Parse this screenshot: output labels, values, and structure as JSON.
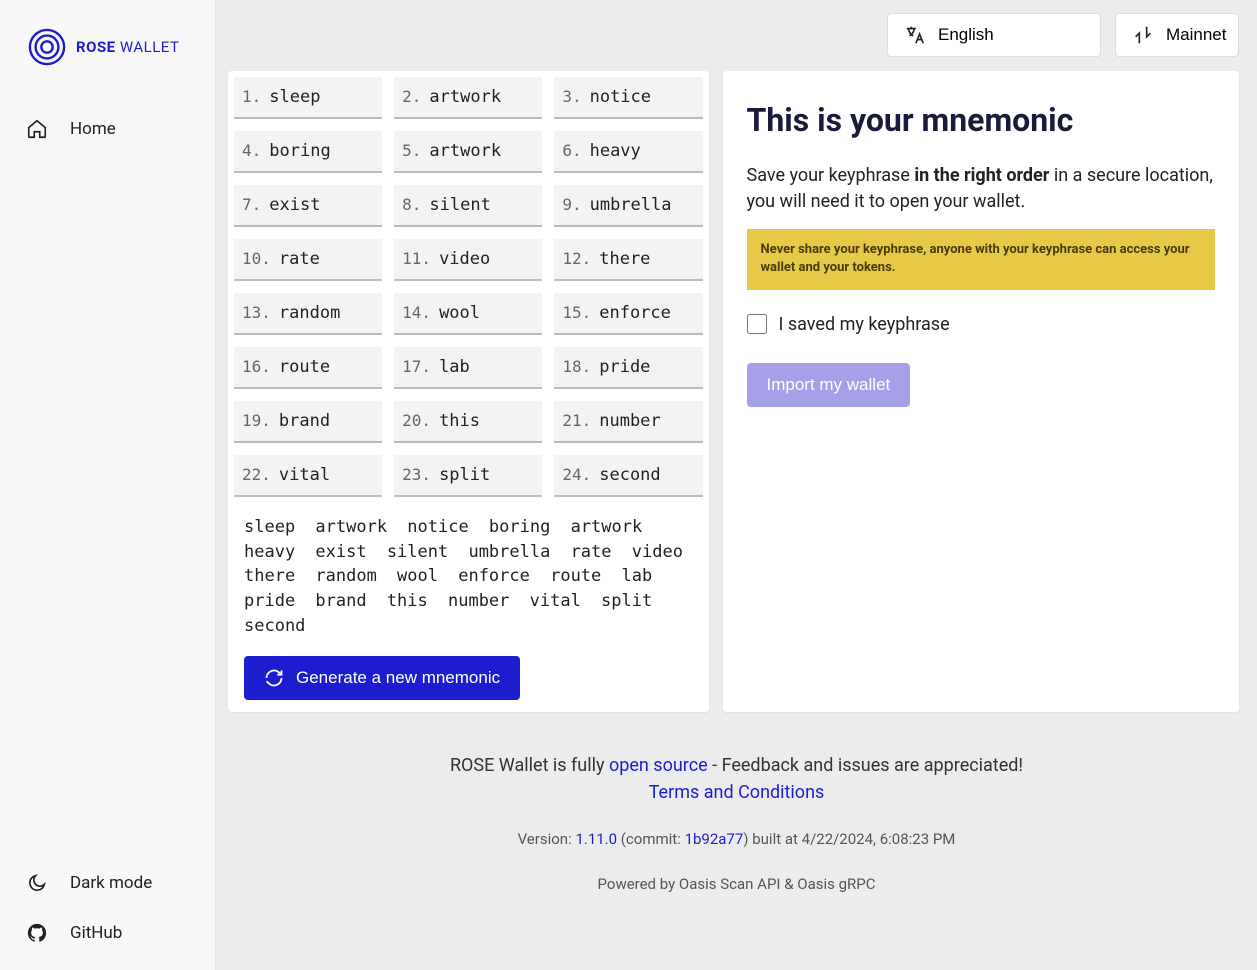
{
  "brand": {
    "rose": "ROSE",
    "wallet": "WALLET"
  },
  "sidebar": {
    "home": "Home",
    "dark": "Dark mode",
    "github": "GitHub"
  },
  "topbar": {
    "language": "English",
    "network": "Mainnet"
  },
  "mnemonic": {
    "words": [
      "sleep",
      "artwork",
      "notice",
      "boring",
      "artwork",
      "heavy",
      "exist",
      "silent",
      "umbrella",
      "rate",
      "video",
      "there",
      "random",
      "wool",
      "enforce",
      "route",
      "lab",
      "pride",
      "brand",
      "this",
      "number",
      "vital",
      "split",
      "second"
    ],
    "generate_label": "Generate a new mnemonic"
  },
  "right": {
    "title": "This is your mnemonic",
    "desc_a": "Save your keyphrase ",
    "desc_b": "in the right order",
    "desc_c": " in a secure location, you will need it to open your wallet.",
    "warn": "Never share your keyphrase, anyone with your keyphrase can access your wallet and your tokens.",
    "check_label": "I saved my keyphrase",
    "import_label": "Import my wallet"
  },
  "footer": {
    "pre": "ROSE Wallet is fully ",
    "opensource": "open source",
    "post": " - Feedback and issues are appreciated!",
    "terms": "Terms and Conditions",
    "version_pre": "Version: ",
    "version": "1.11.0",
    "commit_pre": " (commit: ",
    "commit": "1b92a77",
    "built": ") built at 4/22/2024, 6:08:23 PM",
    "powered": "Powered by Oasis Scan API & Oasis gRPC"
  }
}
